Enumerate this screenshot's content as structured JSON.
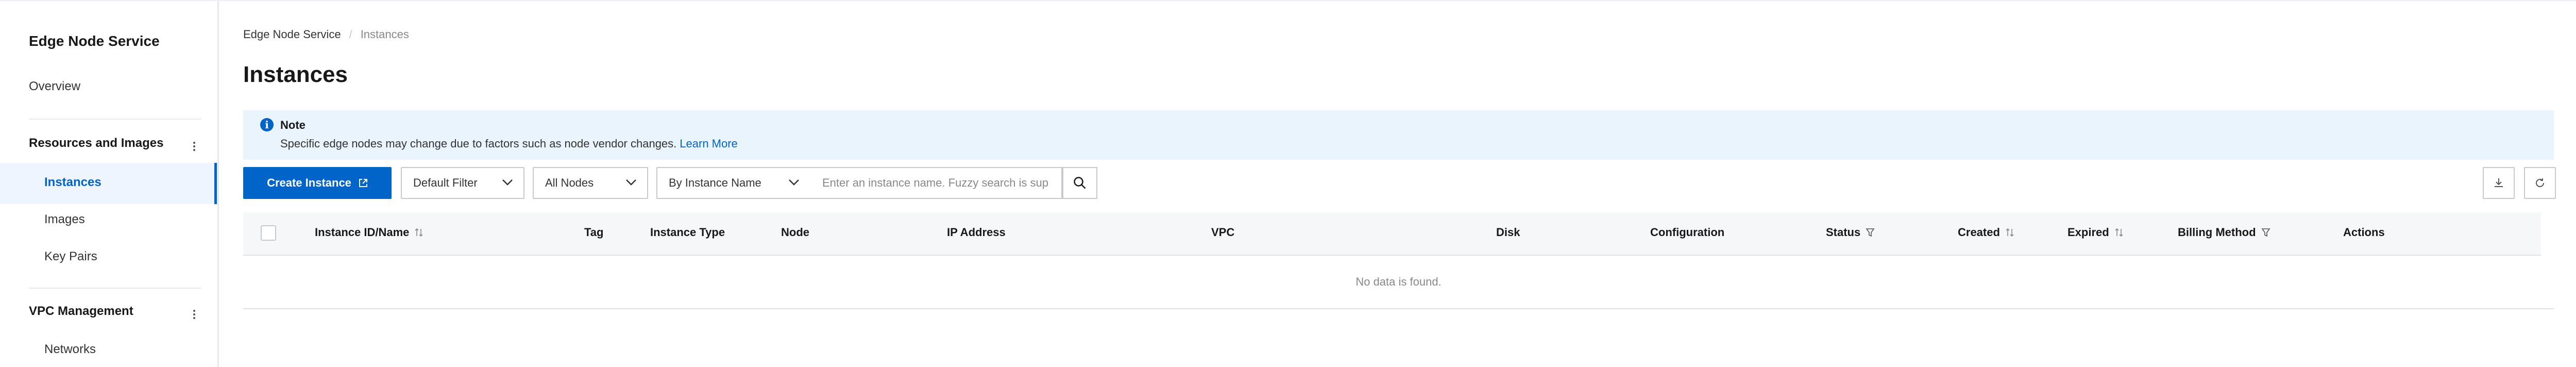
{
  "sidebar": {
    "title": "Edge Node Service",
    "overview": "Overview",
    "groups": [
      {
        "label": "Resources and Images",
        "items": [
          "Instances",
          "Images",
          "Key Pairs"
        ]
      },
      {
        "label": "VPC Management",
        "items": [
          "Networks"
        ]
      }
    ],
    "active_item": "Instances"
  },
  "breadcrumb": {
    "root": "Edge Node Service",
    "separator": "/",
    "current": "Instances"
  },
  "page": {
    "title": "Instances"
  },
  "note": {
    "title": "Note",
    "text": "Specific edge nodes may change due to factors such as node vendor changes.",
    "link": "Learn More"
  },
  "toolbar": {
    "create_label": "Create Instance",
    "filter_value": "Default Filter",
    "nodes_value": "All Nodes",
    "search_by_value": "By Instance Name",
    "search_placeholder": "Enter an instance name. Fuzzy search is supported."
  },
  "table": {
    "columns": [
      "Instance ID/Name",
      "Tag",
      "Instance Type",
      "Node",
      "IP Address",
      "VPC",
      "Disk",
      "Configuration",
      "Status",
      "Created",
      "Expired",
      "Billing Method",
      "Actions"
    ],
    "empty_text": "No data is found."
  },
  "colors": {
    "accent": "#0064c8",
    "note_bg": "#eaf4fd",
    "header_bg": "#f6f7f9"
  },
  "icons": [
    "info-icon",
    "external-link-icon",
    "chevron-down-icon",
    "search-icon",
    "download-icon",
    "refresh-icon",
    "sort-icon",
    "filter-icon",
    "more-icon"
  ]
}
